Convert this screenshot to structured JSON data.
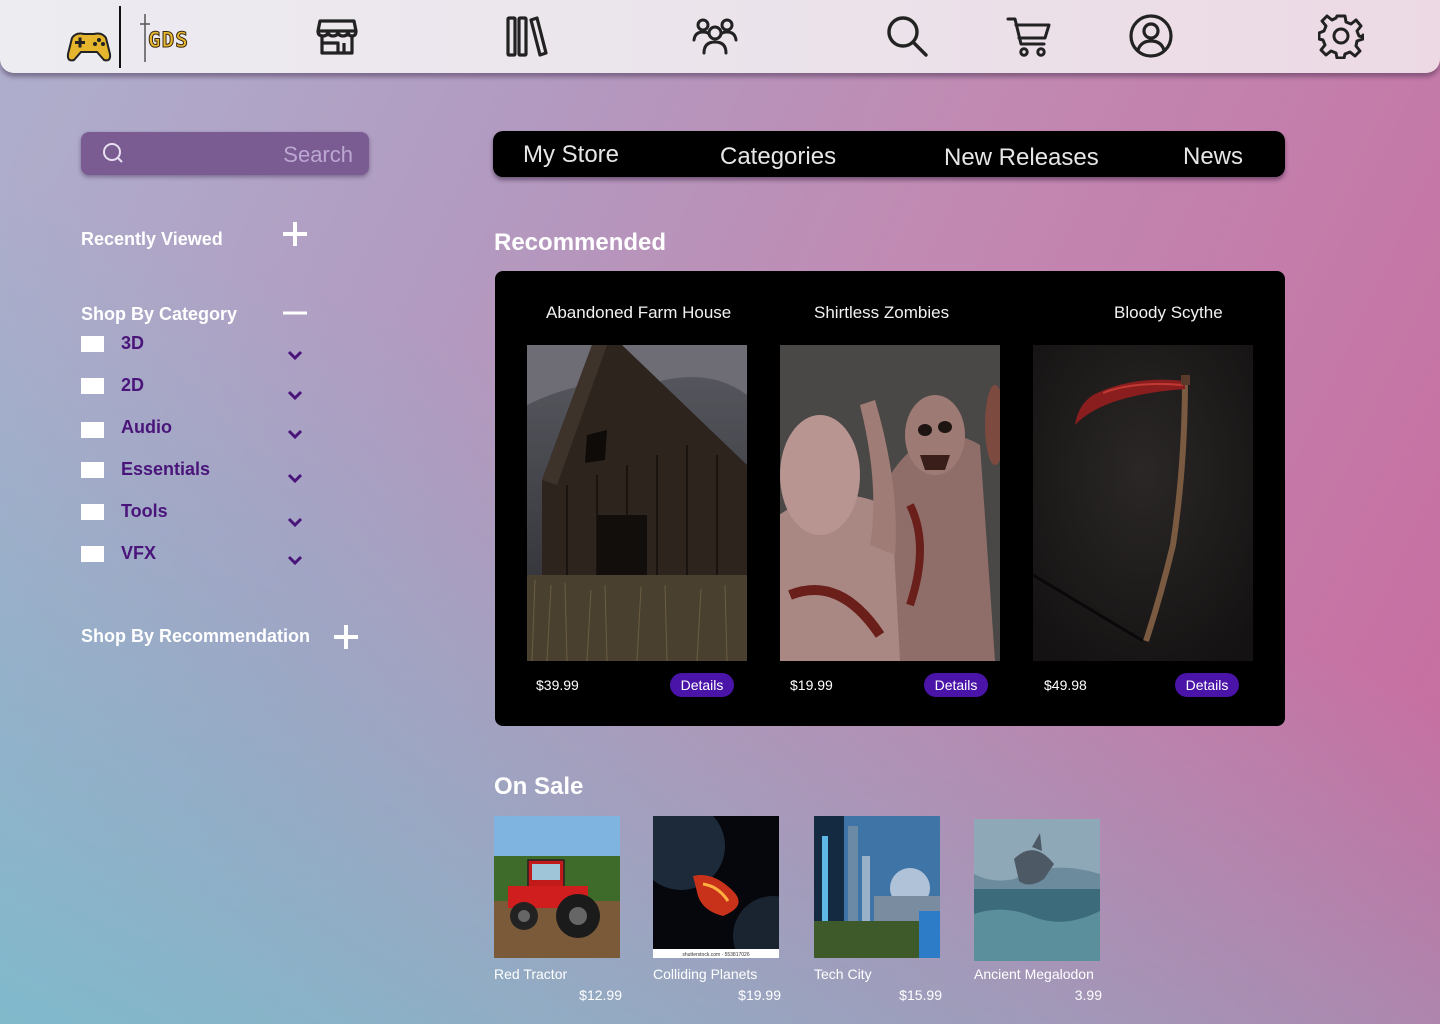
{
  "brand": {
    "logo_text": "GDS"
  },
  "nav": {
    "icons": [
      "gamepad-logo-icon",
      "store-icon",
      "library-icon",
      "community-icon",
      "search-icon",
      "cart-icon",
      "account-icon",
      "settings-icon"
    ]
  },
  "sidebar": {
    "search_placeholder": "Search",
    "recently_viewed": "Recently Viewed",
    "shop_by_category": "Shop By Category",
    "categories": [
      {
        "label": "3D"
      },
      {
        "label": "2D"
      },
      {
        "label": "Audio"
      },
      {
        "label": "Essentials"
      },
      {
        "label": "Tools"
      },
      {
        "label": "VFX"
      }
    ],
    "shop_by_recommendation": "Shop By Recommendation"
  },
  "tabs": [
    {
      "label": "My Store"
    },
    {
      "label": "Categories"
    },
    {
      "label": "New Releases"
    },
    {
      "label": "News"
    }
  ],
  "recommended": {
    "title": "Recommended",
    "items": [
      {
        "name": "Abandoned Farm House",
        "price": "$39.99",
        "button": "Details"
      },
      {
        "name": "Shirtless Zombies",
        "price": "$19.99",
        "button": "Details"
      },
      {
        "name": "Bloody Scythe",
        "price": "$49.98",
        "button": "Details"
      }
    ]
  },
  "on_sale": {
    "title": "On Sale",
    "items": [
      {
        "name": "Red Tractor",
        "price": "$12.99"
      },
      {
        "name": "Colliding Planets",
        "price": "$19.99",
        "watermark": "shutterstock.com · 553817026"
      },
      {
        "name": "Tech City",
        "price": "$15.99"
      },
      {
        "name": "Ancient Megalodon",
        "price": "3.99"
      }
    ]
  },
  "colors": {
    "accent_purple": "#4a14a8",
    "category_text": "#4a157a",
    "search_bg": "#7a5c93",
    "logo_gold": "#e8b830"
  }
}
